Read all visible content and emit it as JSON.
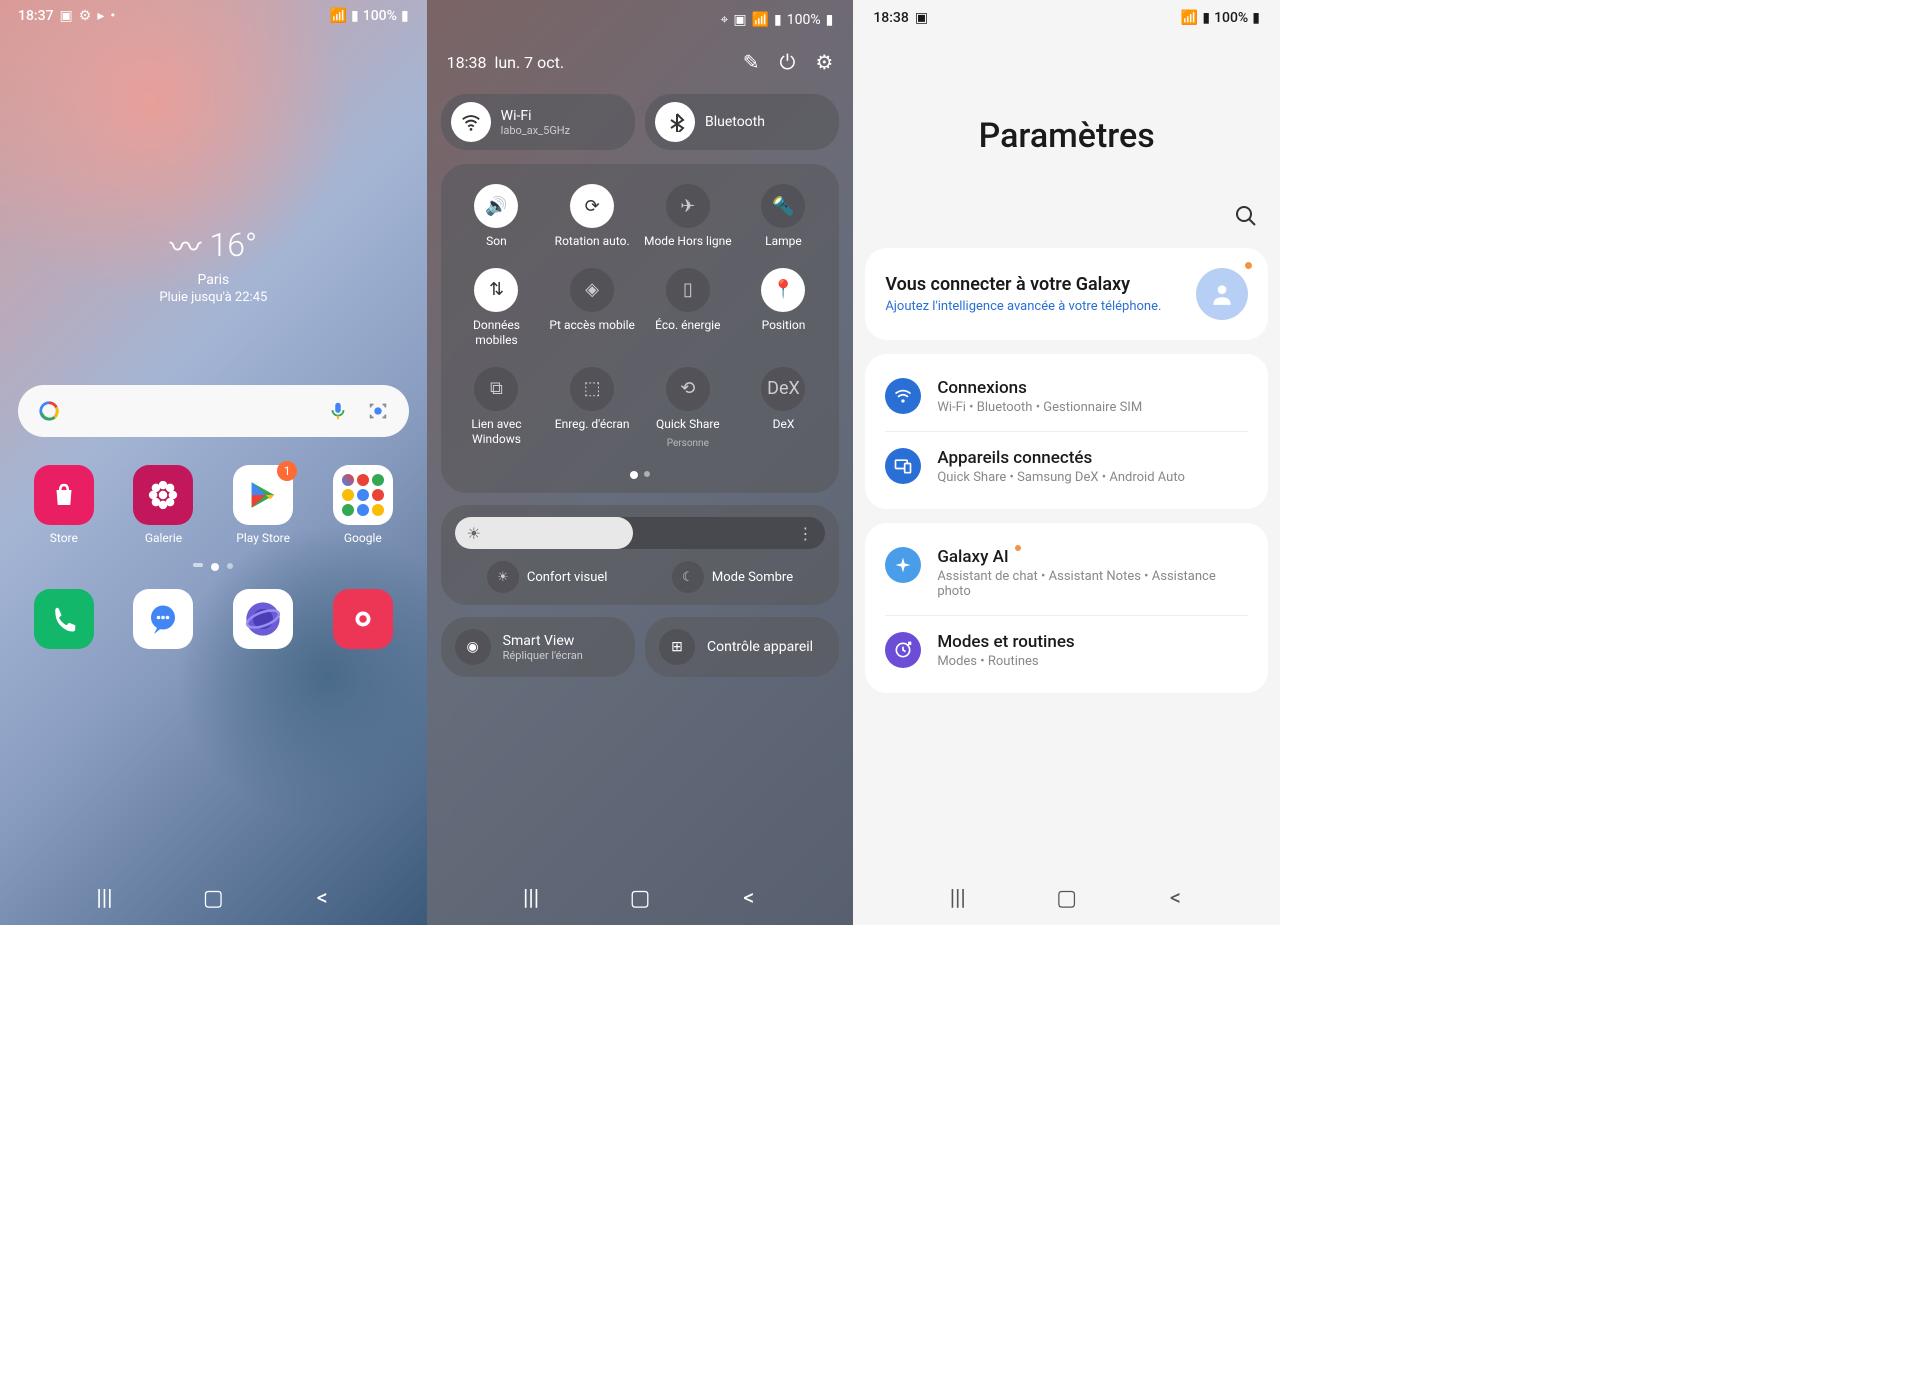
{
  "home": {
    "status": {
      "time": "18:37",
      "battery": "100%"
    },
    "weather": {
      "temp": "16°",
      "city": "Paris",
      "desc": "Pluie jusqu'à 22:45"
    },
    "apps": [
      {
        "label": "Store",
        "bg": "#e91e63",
        "icon": "shopping"
      },
      {
        "label": "Galerie",
        "bg": "#c2185b",
        "icon": "flower"
      },
      {
        "label": "Play Store",
        "bg": "#fff",
        "icon": "play",
        "badge": "1"
      },
      {
        "label": "Google",
        "bg": "#fff",
        "icon": "folder"
      }
    ],
    "dock": [
      {
        "bg": "#12b76a",
        "icon": "phone"
      },
      {
        "bg": "#fff",
        "icon": "messages"
      },
      {
        "bg": "#fff",
        "icon": "browser"
      },
      {
        "bg": "#ed3556",
        "icon": "camera"
      }
    ]
  },
  "qs": {
    "status": {
      "battery": "100%"
    },
    "date": {
      "time": "18:38",
      "day": "lun. 7 oct."
    },
    "wifi": {
      "label": "Wi-Fi",
      "network": "labo_ax_5GHz"
    },
    "bluetooth": {
      "label": "Bluetooth"
    },
    "tiles": [
      {
        "label": "Son",
        "on": true,
        "icon": "volume"
      },
      {
        "label": "Rotation auto.",
        "on": true,
        "icon": "rotate"
      },
      {
        "label": "Mode Hors ligne",
        "on": false,
        "icon": "airplane"
      },
      {
        "label": "Lampe",
        "on": false,
        "icon": "flashlight"
      },
      {
        "label": "Données mobiles",
        "on": true,
        "icon": "data"
      },
      {
        "label": "Pt accès mobile",
        "on": false,
        "icon": "hotspot"
      },
      {
        "label": "Éco. énergie",
        "on": false,
        "icon": "battery"
      },
      {
        "label": "Position",
        "on": true,
        "icon": "location"
      },
      {
        "label": "Lien avec Windows",
        "on": false,
        "icon": "link"
      },
      {
        "label": "Enreg. d'écran",
        "on": false,
        "icon": "record"
      },
      {
        "label": "Quick Share",
        "on": false,
        "icon": "share",
        "sublabel": "Personne"
      },
      {
        "label": "DeX",
        "on": false,
        "icon": "dex"
      }
    ],
    "comfort": "Confort visuel",
    "dark": "Mode Sombre",
    "smartview": {
      "label": "Smart View",
      "desc": "Répliquer l'écran"
    },
    "devices": "Contrôle appareil"
  },
  "settings": {
    "status": {
      "time": "18:38",
      "battery": "100%"
    },
    "title": "Paramètres",
    "signin": {
      "title": "Vous connecter à votre Galaxy",
      "desc": "Ajoutez l'intelligence avancée à votre téléphone."
    },
    "items": [
      {
        "title": "Connexions",
        "desc": "Wi-Fi • Bluetooth • Gestionnaire SIM",
        "color": "#2a6fd6",
        "icon": "wifi"
      },
      {
        "title": "Appareils connectés",
        "desc": "Quick Share • Samsung DeX • Android Auto",
        "color": "#2a6fd6",
        "icon": "devices"
      },
      {
        "title": "Galaxy AI",
        "desc": "Assistant de chat • Assistant Notes • Assistance photo",
        "color": "#4a9de8",
        "icon": "sparkle",
        "dot": true
      },
      {
        "title": "Modes et routines",
        "desc": "Modes • Routines",
        "color": "#6b4dd6",
        "icon": "routine"
      }
    ]
  }
}
